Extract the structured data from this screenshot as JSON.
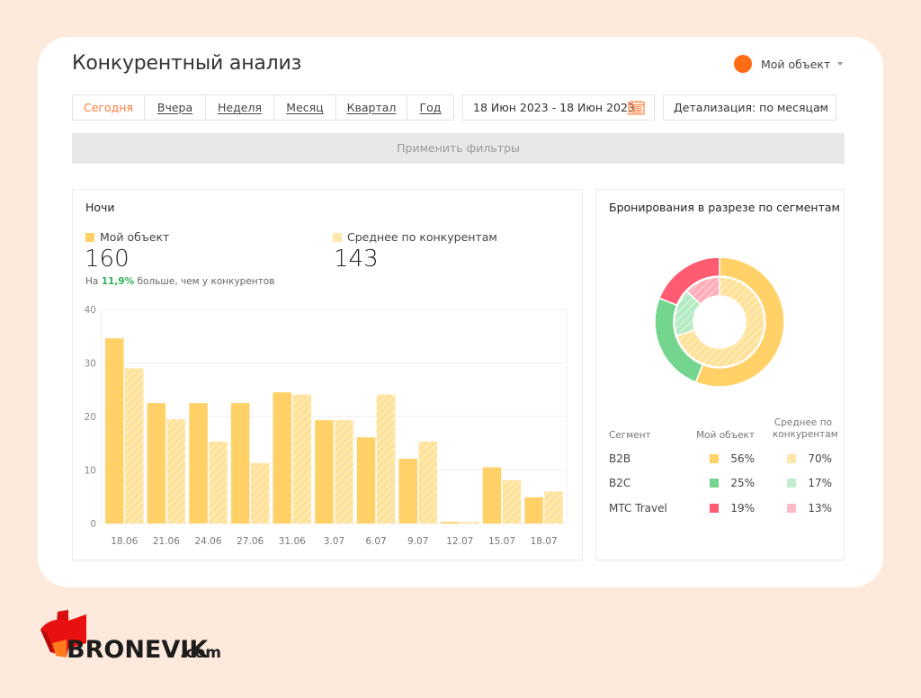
{
  "page": {
    "title": "Конкурентный анализ",
    "user_menu": {
      "label": "Мой объект",
      "avatar_color": "#ff6a14"
    }
  },
  "filters": {
    "periods": [
      "Сегодня",
      "Вчера",
      "Неделя",
      "Месяц",
      "Квартал",
      "Год"
    ],
    "active_period": "Сегодня",
    "date_range": "18 Июн 2023 - 18 Июн 2023",
    "detail_select": "Детализация: по месяцам",
    "apply_label": "Применить фильтры"
  },
  "nights": {
    "title": "Ночи",
    "mine_label": "Мой объект",
    "mine_value": "160",
    "comp_label": "Среднее по конкурентам",
    "comp_value": "143",
    "comparison_prefix": "На",
    "comparison_pct": "11,9%",
    "comparison_suffix": "больше, чем у конкурентов"
  },
  "segments": {
    "title": "Бронирования в разрезе по сегментам",
    "headers": {
      "segment": "Сегмент",
      "mine": "Мой объект",
      "comp": "Среднее по конкурентам"
    },
    "rows": [
      {
        "name": "B2B",
        "mine": "56%",
        "comp": "70%",
        "color": "#ffd166",
        "comp_color": "#ffe29a"
      },
      {
        "name": "B2C",
        "mine": "25%",
        "comp": "17%",
        "color": "#74d68e",
        "comp_color": "#b3ebc2"
      },
      {
        "name": "MTC Travel",
        "mine": "19%",
        "comp": "13%",
        "color": "#ff5c72",
        "comp_color": "#ffadb8"
      }
    ]
  },
  "brand": {
    "name": "BRONEVIK",
    "suffix": ".com"
  },
  "chart_data": [
    {
      "type": "bar",
      "title": "Ночи",
      "categories": [
        "18.06",
        "",
        "",
        "21.06",
        "",
        "",
        "24.06",
        "",
        "",
        "27.06",
        "",
        "",
        "31.06",
        "",
        "",
        "3.07",
        "",
        "",
        "6.07",
        "",
        "",
        "9.07",
        "",
        "",
        "12.07",
        "",
        "",
        "15.07",
        "",
        "",
        "18.07"
      ],
      "x_labels": [
        "18.06",
        "21.06",
        "24.06",
        "27.06",
        "31.06",
        "3.07",
        "6.07",
        "9.07",
        "12.07",
        "15.07",
        "18.07"
      ],
      "series": [
        {
          "name": "Мой объект",
          "color": "#ffd166",
          "values": [
            34.6,
            22.5,
            22.5,
            22.5,
            24.5,
            19.3,
            16.1,
            12.1,
            0.3,
            10.5,
            4.9
          ]
        },
        {
          "name": "Среднее по конкурентам",
          "color": "#ffe29a",
          "pattern": "hatched",
          "values": [
            29.0,
            19.5,
            15.3,
            11.3,
            24.1,
            19.3,
            24.1,
            15.3,
            0.3,
            8.1,
            6.0
          ]
        }
      ],
      "yticks": [
        0,
        10,
        20,
        30,
        40
      ],
      "ylim": [
        0,
        40
      ],
      "xlabel": "",
      "ylabel": "",
      "grid": true,
      "legend": "top"
    },
    {
      "type": "pie",
      "title": "Бронирования в разрезе по сегментам",
      "variant": "nested-donut",
      "categories": [
        "B2B",
        "B2C",
        "MTC Travel"
      ],
      "series": [
        {
          "name": "Мой объект",
          "ring": "outer",
          "values": [
            56,
            25,
            19
          ],
          "colors": [
            "#ffd166",
            "#74d68e",
            "#ff5c72"
          ]
        },
        {
          "name": "Среднее по конкурентам",
          "ring": "inner",
          "pattern": "hatched",
          "values": [
            70,
            17,
            13
          ],
          "colors": [
            "#ffe29a",
            "#b3ebc2",
            "#ffadb8"
          ]
        }
      ]
    }
  ]
}
